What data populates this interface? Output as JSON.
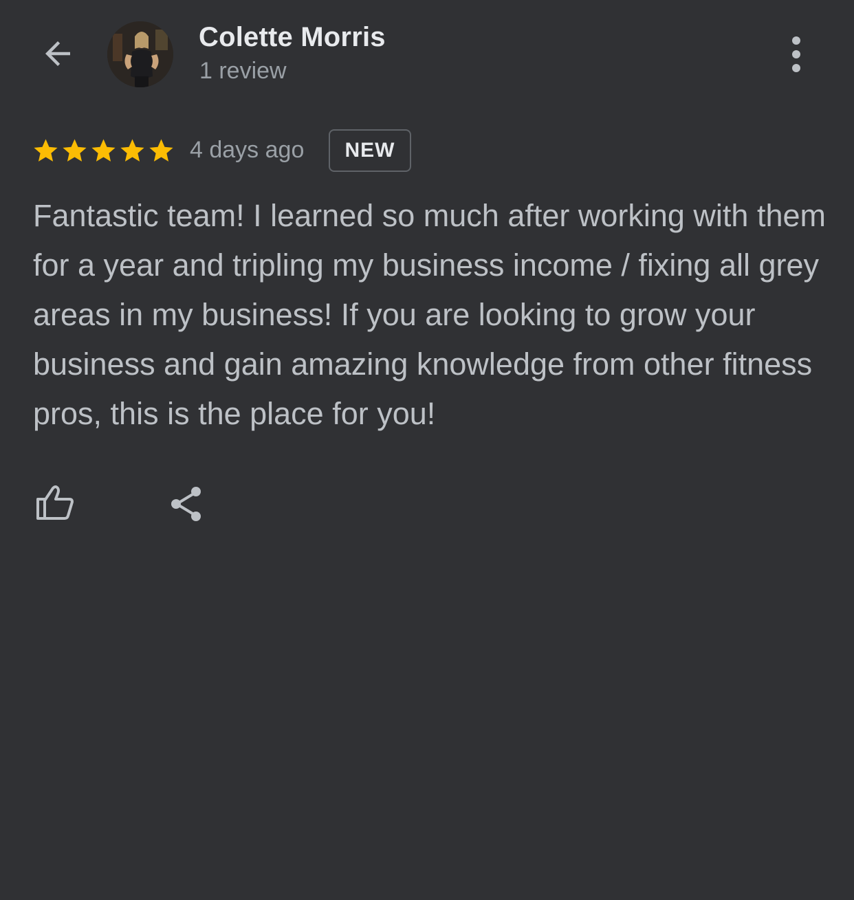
{
  "header": {
    "back_icon": "arrow-back-icon",
    "avatar_icon": "reviewer-avatar",
    "reviewer_name": "Colette Morris",
    "review_count": "1 review",
    "more_icon": "more-vert-icon"
  },
  "review": {
    "rating": 5,
    "rating_max": 5,
    "star_color": "#fbbc04",
    "date": "4 days ago",
    "badge": "NEW",
    "text": "Fantastic team! I learned so much after working with them for a year and tripling my business income / fixing all grey areas in my business! If you are looking to grow your business and gain amazing knowledge from other fitness pros, this is the place for you!"
  },
  "actions": {
    "like_icon": "thumb-up-icon",
    "share_icon": "share-icon"
  },
  "colors": {
    "background": "#303134",
    "primary_text": "#e8eaed",
    "secondary_text": "#9aa0a6",
    "body_text": "#bdc1c6"
  }
}
